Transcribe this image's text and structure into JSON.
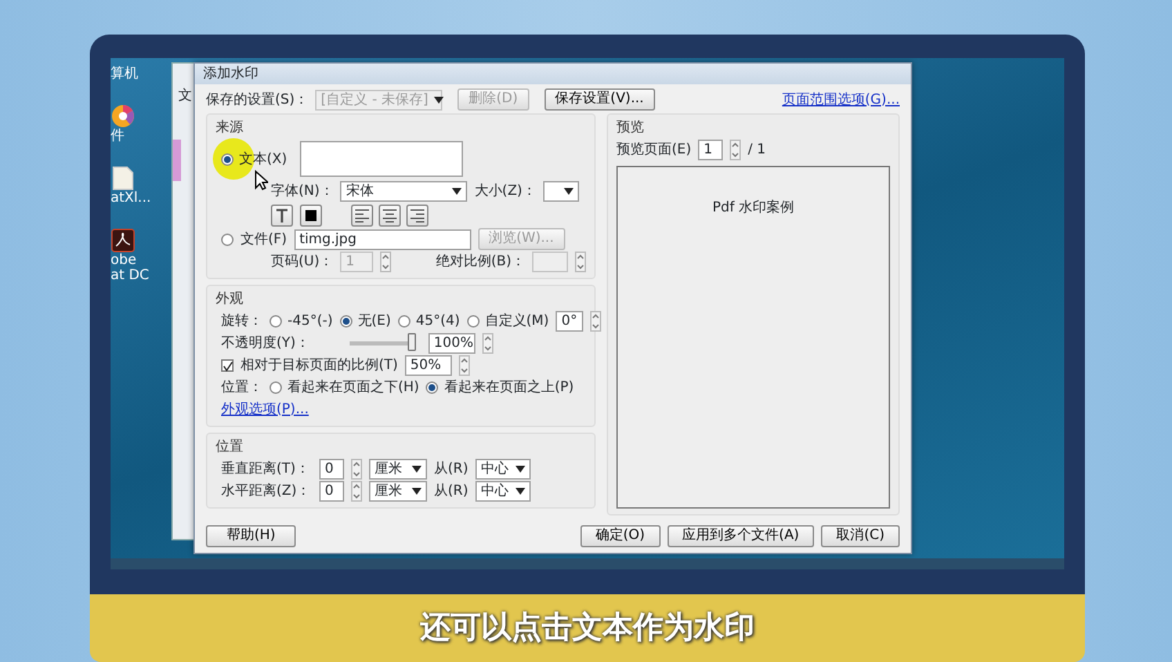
{
  "desktop_icons": [
    {
      "kind": "computer",
      "lines": [
        "算机"
      ]
    },
    {
      "kind": "color-wheel",
      "lines": [
        "件"
      ]
    },
    {
      "kind": "document",
      "lines": [
        "atXl..."
      ]
    },
    {
      "kind": "pdf",
      "lines": [
        "obe",
        "at DC"
      ]
    }
  ],
  "background_window": {
    "menu_text": "文"
  },
  "dialog": {
    "title": "添加水印",
    "saved_settings": {
      "label": "保存的设置(S)：",
      "value": "[自定义 - 未保存]",
      "disabled": true
    },
    "top_buttons": [
      {
        "label": "删除(D)",
        "disabled": true
      },
      {
        "label": "保存设置(V)...",
        "disabled": false
      }
    ],
    "page_range_link": "页面范围选项(G)...",
    "source": {
      "title": "来源",
      "options": [
        {
          "label": "文本(X)",
          "selected": true
        },
        {
          "label": "文件(F)",
          "selected": false
        }
      ],
      "font_label": "字体(N)：",
      "font_value": "宋体",
      "size_label": "大小(Z)：",
      "file_value": "timg.jpg",
      "browse": {
        "label": "浏览(W)...",
        "disabled": true
      },
      "page_label": "页码(U)：",
      "page_value": "1",
      "page_disabled": true,
      "scale_label": "绝对比例(B)：",
      "scale_disabled": true
    },
    "appearance": {
      "title": "外观",
      "rotation_label": "旋转：",
      "rotations": [
        {
          "label": "-45°(-)",
          "selected": false
        },
        {
          "label": "无(E)",
          "selected": true
        },
        {
          "label": "45°(4)",
          "selected": false
        },
        {
          "label": "自定义(M)",
          "selected": false
        }
      ],
      "custom_value": "0°",
      "opacity_label": "不透明度(Y)：",
      "opacity": {
        "level": 1.0
      },
      "opacity_value": "100%",
      "relative_scale": {
        "label": "相对于目标页面的比例(T)",
        "checked": true,
        "value": "50%"
      },
      "position_label": "位置：",
      "positions": [
        {
          "label": "看起来在页面之下(H)",
          "selected": false
        },
        {
          "label": "看起来在页面之上(P)",
          "selected": true
        }
      ],
      "options_link": "外观选项(P)..."
    },
    "position": {
      "title": "位置",
      "rows": [
        {
          "label": "垂直距离(T)：",
          "value": "0",
          "unit": "厘米",
          "from": "从(R)",
          "anchor": "中心"
        },
        {
          "label": "水平距离(Z)：",
          "value": "0",
          "unit": "厘米",
          "from": "从(R)",
          "anchor": "中心"
        }
      ]
    },
    "preview": {
      "title": "预览",
      "page_label": "预览页面(E)",
      "page_value": "1",
      "total": "/ 1",
      "page_text": "Pdf 水印案例"
    },
    "help_button": "帮助(H)",
    "bottom_buttons": [
      "确定(O)",
      "应用到多个文件(A)",
      "取消(C)"
    ]
  },
  "caption": "还可以点击文本作为水印"
}
